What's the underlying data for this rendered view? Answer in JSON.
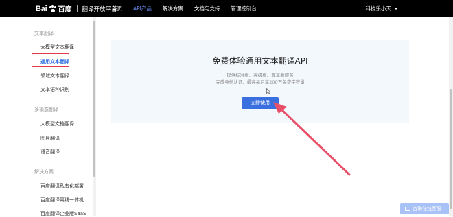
{
  "header": {
    "brand_bai": "Bai",
    "brand_du": "百度",
    "platform": "翻译开放平台",
    "nav": [
      {
        "label": "首页"
      },
      {
        "label": "API产品",
        "active": true
      },
      {
        "label": "解决方案"
      },
      {
        "label": "文档与支持"
      },
      {
        "label": "管理控制台"
      }
    ],
    "user": "科技乐小天"
  },
  "sidebar": {
    "groups": [
      {
        "title": "文本翻译",
        "items": [
          "大模型文本翻译",
          "通用文本翻译",
          "领域文本翻译",
          "文本语种识别"
        ]
      },
      {
        "title": "多模态翻译",
        "items": [
          "大模型文档翻译",
          "图片翻译",
          "语音翻译"
        ]
      },
      {
        "title": "解决方案",
        "items": [
          "百度翻译私有化部署",
          "百度翻译离线一体机",
          "百度翻译企业版SaaS"
        ]
      }
    ],
    "active_item": "通用文本翻译"
  },
  "promo": {
    "title": "免费体验通用文本翻译API",
    "desc_line1": "提供标准版、高级版、尊享版服务",
    "desc_line2": "完成身份认证，最高每月享200万免费字符量",
    "button": "立即使用"
  },
  "chat_button": "咨询在线客服",
  "colors": {
    "topbar": "#000000",
    "nav_active": "#6b93ff",
    "primary": "#3a6fe0",
    "annotation_red": "#e23a4d",
    "card_bg": "#f3f8fd"
  }
}
